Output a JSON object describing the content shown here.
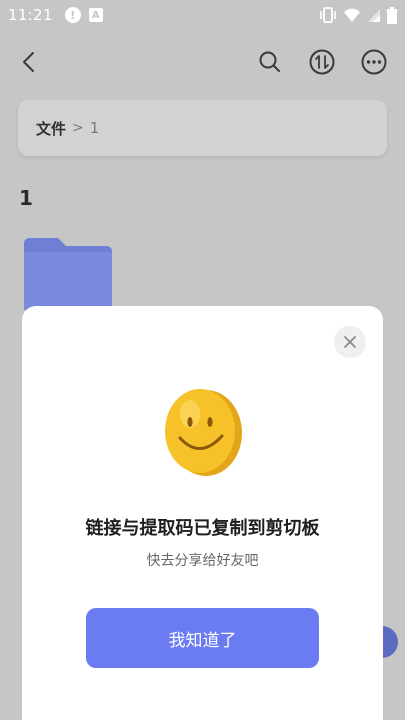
{
  "status_bar": {
    "time": "11:21",
    "icons": [
      "alert-icon",
      "a-icon",
      "vibrate-icon",
      "wifi-icon",
      "signal-icon",
      "battery-icon"
    ]
  },
  "header": {
    "icons": [
      "back-icon",
      "search-icon",
      "sort-icon",
      "more-icon"
    ]
  },
  "breadcrumb": {
    "root": "文件",
    "separator": ">",
    "current": "1"
  },
  "folder_section": {
    "title": "1"
  },
  "modal": {
    "title": "链接与提取码已复制到剪切板",
    "subtitle": "快去分享给好友吧",
    "confirm_label": "我知道了"
  },
  "colors": {
    "overlay_bg": "#c6c6c6",
    "accent": "#6b7cf3",
    "folder": "#6f7fd6",
    "smiley": "#f7c229"
  }
}
